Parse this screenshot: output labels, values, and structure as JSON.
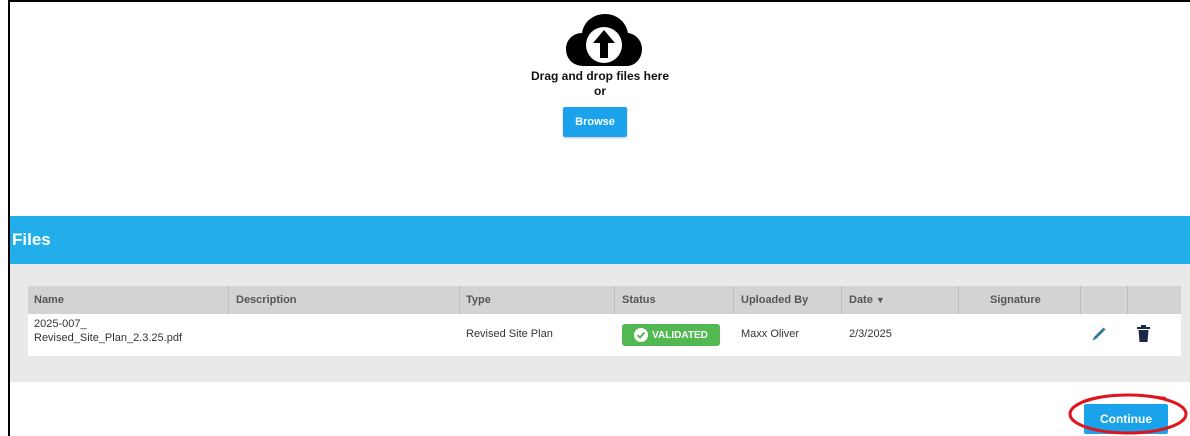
{
  "upload": {
    "drag_text": "Drag and drop files here",
    "or_text": "or",
    "browse_label": "Browse",
    "icon": "cloud-upload-icon"
  },
  "files": {
    "title": "Files",
    "columns": [
      "Name",
      "Description",
      "Type",
      "Status",
      "Uploaded By",
      "Date",
      "Signature"
    ],
    "sort_indicator": "▼",
    "rows": [
      {
        "name_line1": "2025-007_",
        "name_line2": "Revised_Site_Plan_2.3.25.pdf",
        "description": "",
        "type": "Revised Site Plan",
        "status": "VALIDATED",
        "uploaded_by": "Maxx Oliver",
        "date": "2/3/2025",
        "signature": ""
      }
    ]
  },
  "footer": {
    "continue_label": "Continue"
  },
  "colors": {
    "accent": "#22aeea",
    "button": "#1aa3ea",
    "validated": "#52b852",
    "highlight": "#e0141c"
  }
}
